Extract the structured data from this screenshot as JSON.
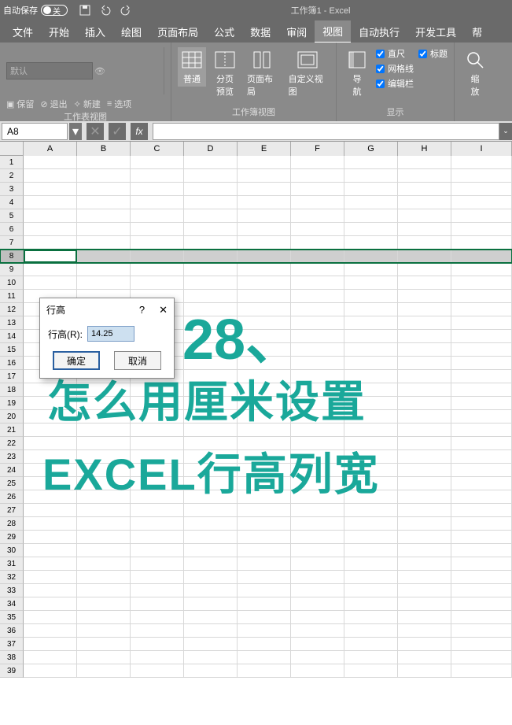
{
  "titlebar": {
    "autosave": "自动保存",
    "toggle_state": "关",
    "title": "工作簿1 - Excel"
  },
  "menu": {
    "items": [
      "文件",
      "开始",
      "插入",
      "绘图",
      "页面布局",
      "公式",
      "数据",
      "审阅",
      "视图",
      "自动执行",
      "开发工具",
      "帮"
    ]
  },
  "ribbon": {
    "group1_dd": "默认",
    "group1_btns": {
      "keep": "保留",
      "exit": "退出",
      "new": "新建",
      "options": "选项"
    },
    "group1_label": "工作表视图",
    "group2": {
      "normal": "普通",
      "page_break": "分页\n预览",
      "page_layout": "页面布局",
      "custom": "自定义视图",
      "label": "工作簿视图"
    },
    "group3": {
      "nav": "导\n航",
      "ruler": "直尺",
      "headings": "标题",
      "gridlines": "网格线",
      "formula_bar": "编辑栏",
      "label": "显示"
    },
    "group4": {
      "zoom": "缩\n放"
    }
  },
  "formula_bar": {
    "name_box": "A8",
    "fx": "fx"
  },
  "columns": [
    "A",
    "B",
    "C",
    "D",
    "E",
    "F",
    "G",
    "H",
    "I"
  ],
  "selected_row": 8,
  "dialog": {
    "title": "行高",
    "label": "行高(R):",
    "value": "14.25",
    "ok": "确定",
    "cancel": "取消"
  },
  "overlay": {
    "num": "28、",
    "line1": "怎么用厘米设置",
    "line2": "EXCEL行高列宽"
  }
}
